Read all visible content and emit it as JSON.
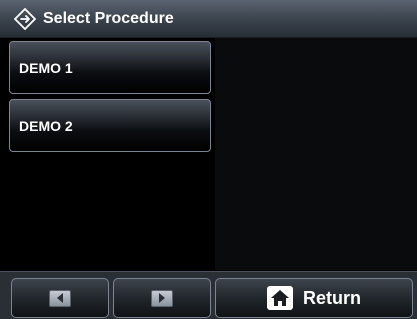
{
  "header": {
    "title": "Select Procedure",
    "icon": "navigate-arrows-icon"
  },
  "procedures": [
    {
      "label": "DEMO 1"
    },
    {
      "label": "DEMO 2"
    }
  ],
  "footer": {
    "prev_icon": "arrow-left-icon",
    "next_icon": "arrow-right-icon",
    "return_icon": "home-icon",
    "return_label": "Return"
  },
  "colors": {
    "background": "#000000",
    "titlebar": "#3c444e",
    "button_border": "#7d8590",
    "text": "#ffffff"
  }
}
